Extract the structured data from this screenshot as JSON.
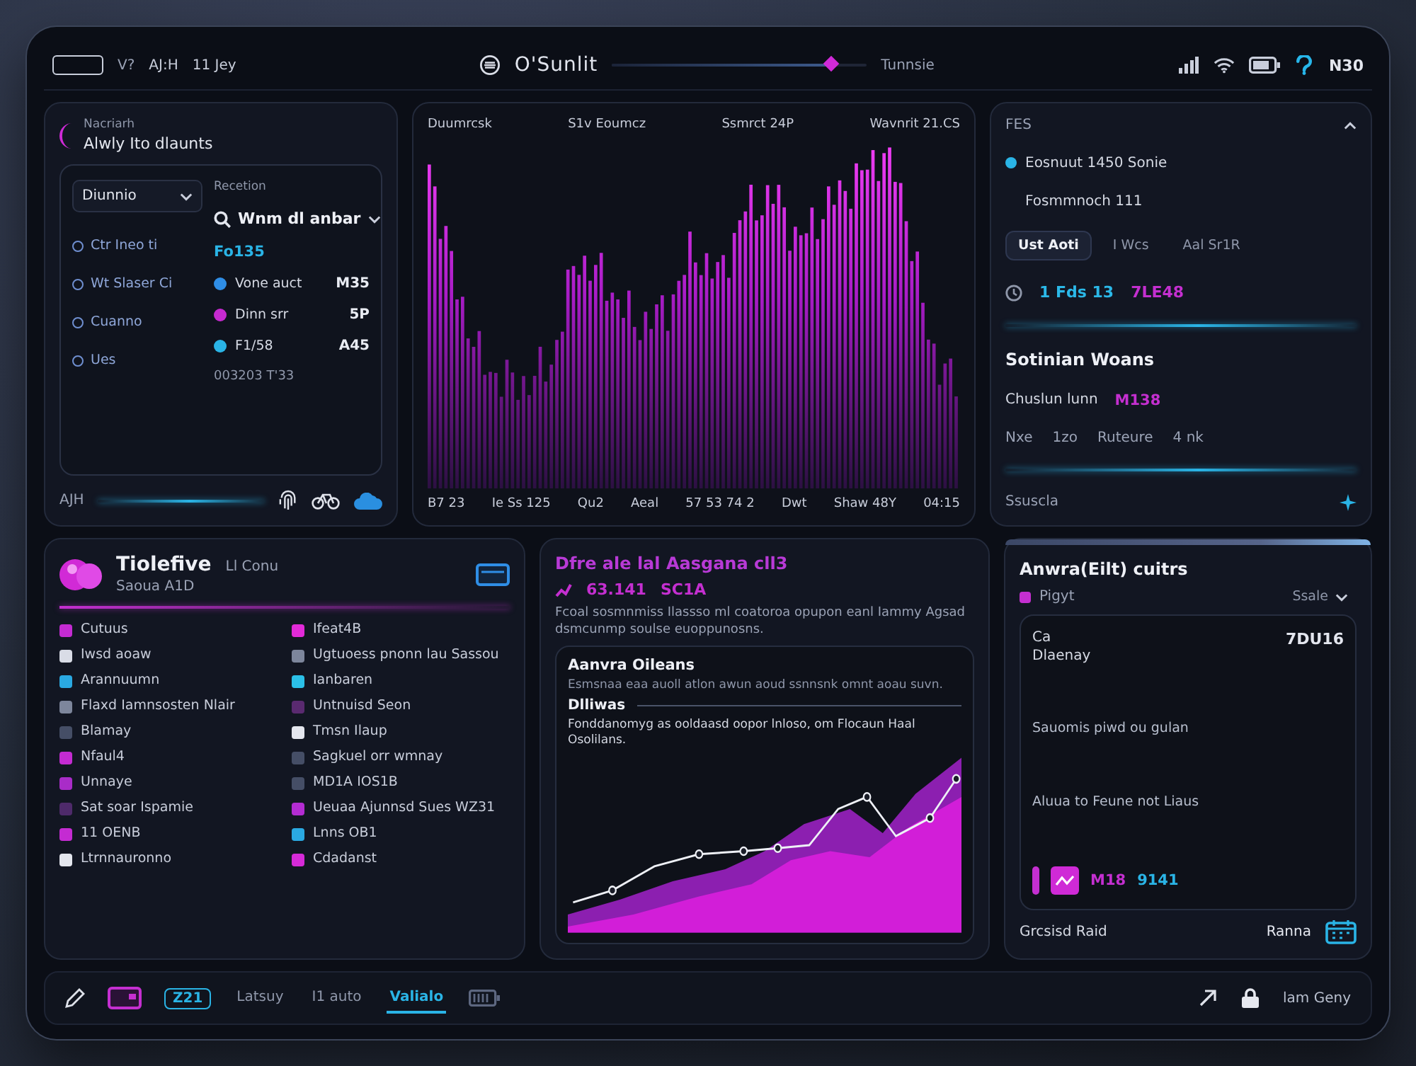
{
  "top_bar": {
    "field_label": "V?",
    "nav_labels": [
      "AJ:H",
      "11 Jey"
    ],
    "title": "O'Sunlit",
    "timeline": {
      "level": 0.86
    },
    "timeline_label": "Tunnsie",
    "clock": "N30"
  },
  "overview_panel": {
    "eyebrow": "Nacriarh",
    "title": "Alwly Ito dlaunts",
    "dropdown": "Diunnio",
    "filters": [
      "Ctr Ineo ti",
      "Wt Slaser Ci",
      "Cuanno",
      "Ues"
    ],
    "section_label": "Recetion",
    "section_title": "Wnm dl anbar",
    "section_value": "Fo135",
    "metrics": [
      {
        "label": "Vone auct",
        "value": "M35",
        "color": "#2f8ee6"
      },
      {
        "label": "Dinn srr",
        "value": "5P",
        "color": "#c62ad0"
      },
      {
        "label": "F1/58",
        "value": "A45",
        "color": "#2ab4e6"
      }
    ],
    "footnote": "003203 T'33",
    "footer_label": "AJH"
  },
  "chart_panel": {
    "labels_top": [
      "Duumrcsk",
      "S1v Eoumcz",
      "Ssmrct 24P",
      "Wavnrit 21.CS"
    ],
    "labels_bottom": [
      "B7 23",
      "Ie Ss 125",
      "Qu2",
      "Aeal",
      "57 53 74 2",
      "Dwt",
      "Shaw 48Y",
      "04:15"
    ]
  },
  "activity_panel": {
    "header": "FES",
    "headline": "Eosnuut 1450 Sonie",
    "subline": "Fosmmnoch 111",
    "chips": [
      {
        "label": "Ust Aoti",
        "selected": true
      },
      {
        "label": "I Wcs",
        "selected": false
      },
      {
        "label": "Aal Sr1R",
        "selected": false
      }
    ],
    "stats": [
      {
        "value": "1 Fds 13",
        "color": "#2bb8e8"
      },
      {
        "value": "7LE48",
        "color": "#c42fd0"
      }
    ],
    "title": "Sotinian Woans",
    "subtitle": "Chuslun lunn",
    "badge": "M138",
    "meta": [
      "Nxe",
      "1zo",
      "Ruteure",
      "4 nk"
    ],
    "footer": "Ssuscla"
  },
  "team_panel": {
    "title": "Tiolefive",
    "aside": "Ll Conu",
    "subtitle": "Saoua A1D",
    "left_list": [
      {
        "label": "Cutuus",
        "color": "#c42bd2"
      },
      {
        "label": "Iwsd aoaw",
        "color": "#d9dce6"
      },
      {
        "label": "Arannuumn",
        "color": "#2aa9e2"
      },
      {
        "label": "Flaxd Iamnsosten Nlair",
        "color": "#7d869c"
      },
      {
        "label": "Blamay",
        "color": "#454e66"
      },
      {
        "label": "Nfaul4",
        "color": "#c42bd2"
      },
      {
        "label": "Unnaye",
        "color": "#a92cc8"
      },
      {
        "label": "Sat soar Ispamie",
        "color": "#4e2a6a"
      },
      {
        "label": "11 OENB",
        "color": "#c42bd2"
      },
      {
        "label": "Ltrnnauronno",
        "color": "#e4e6ee"
      }
    ],
    "right_list": [
      {
        "label": "Ifeat4B",
        "color": "#e22ad8"
      },
      {
        "label": "Ugtuoess pnonn lau Sassou",
        "color": "#7d869c"
      },
      {
        "label": "Ianbaren",
        "color": "#2bc0e8"
      },
      {
        "label": "Untnuisd Seon",
        "color": "#5a2a70"
      },
      {
        "label": "Tmsn Ilaup",
        "color": "#e4e6ee"
      },
      {
        "label": "Sagkuel orr wmnay",
        "color": "#454e66"
      },
      {
        "label": "MD1A IOS1B",
        "color": "#454e66"
      },
      {
        "label": "Ueuaa Ajunnsd Sues WZ31",
        "color": "#b32cd2"
      },
      {
        "label": "Lnns OB1",
        "color": "#2aa9e2"
      },
      {
        "label": "Cdadanst",
        "color": "#d62ad8"
      }
    ]
  },
  "insight_panel": {
    "headline": "Dfre ale lal Aasgana cll3",
    "kpis": [
      "63.141",
      "SC1A"
    ],
    "paragraph": "Fcoal sosmnmiss Ilassso ml coatoroa opupon eanl Iammy Agsad dsmcunmp soulse euoppunosns.",
    "card": {
      "title": "Aanvra Oileans",
      "text": "Esmsnaa eaa auoll atlon awun aoud ssnnsnk omnt aoau suvn.",
      "chart_label": "Dlliwas",
      "chart_caption": "Fonddanomyg as ooldaasd oopor lnloso, om Flocaun Haal Osolilans."
    }
  },
  "summary_panel": {
    "title": "Anwra(Eilt) cuitrs",
    "tag": "Pigyt",
    "dropdown": "Ssale",
    "labels": [
      "Ca",
      "Dlaenay"
    ],
    "value": "7DU16",
    "lines": [
      "Sauomis piwd ou gulan",
      "Aluua to Feune not Liaus"
    ],
    "badge": "M18",
    "stat": "9141",
    "footer": "Grcsisd Raid",
    "action": "Ranna"
  },
  "toolbar": {
    "badge": "Z21",
    "tabs": [
      {
        "label": "Latsuy",
        "selected": false
      },
      {
        "label": "I1 auto",
        "selected": false
      },
      {
        "label": "Valialo",
        "selected": true
      }
    ],
    "account": "lam Geny"
  }
}
